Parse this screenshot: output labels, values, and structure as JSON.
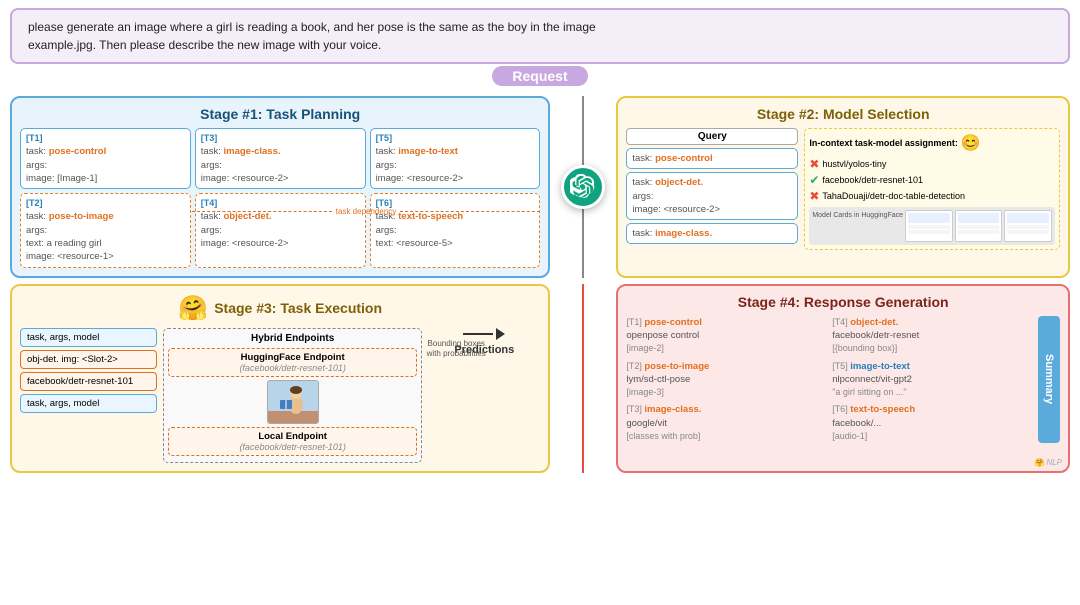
{
  "request": {
    "text_line1": "please generate an image where a girl is reading a book, and her pose is the same as the boy in the image",
    "text_line2": "example.jpg. Then please describe the new image with your voice.",
    "label": "Request"
  },
  "stage1": {
    "title": "Stage #1: Task Planning",
    "tasks": [
      {
        "id": "[T1]",
        "task_label": "task:",
        "task_value": "pose-control",
        "args_label": "args:",
        "image_label": "image:",
        "image_value": "[Image-1]"
      },
      {
        "id": "[T3]",
        "task_label": "task:",
        "task_value": "image-class.",
        "args_label": "args:",
        "image_label": "image:",
        "image_value": "<resource-2>"
      },
      {
        "id": "[T5]",
        "task_label": "task:",
        "task_value": "image-to-text",
        "args_label": "args:",
        "image_label": "image:",
        "image_value": "<resource-2>"
      },
      {
        "id": "[T2]",
        "task_label": "task:",
        "task_value": "pose-to-image",
        "args_label": "args:",
        "text_label": "text:",
        "text_value": "a reading girl",
        "image_label": "image:",
        "image_value": "<resource-1>"
      },
      {
        "id": "[T4]",
        "task_label": "task:",
        "task_value": "object-det.",
        "args_label": "args:",
        "image_label": "image:",
        "image_value": "<resource-2>"
      },
      {
        "id": "[T6]",
        "task_label": "task:",
        "task_value": "text-to-speech",
        "args_label": "args:",
        "text_label": "text:",
        "text_value": "<resource-5>"
      }
    ],
    "dep_label": "task dependency"
  },
  "stage2": {
    "title": "Stage #2: Model Selection",
    "query_label": "Query",
    "query_tasks": [
      {
        "label": "task:",
        "value": "pose-control",
        "color": "orange"
      },
      {
        "label": "task:",
        "value": "object-det.",
        "args": "args:",
        "image": "image:",
        "image_val": "<resource-2>",
        "color": "orange"
      },
      {
        "label": "task:",
        "value": "image-class.",
        "color": "orange"
      }
    ],
    "inctx_title": "In-context task-model assignment:",
    "models": [
      {
        "icon": "cross",
        "name": "hustvl/yolos-tiny"
      },
      {
        "icon": "check",
        "name": "facebook/detr-resnet-101"
      },
      {
        "icon": "cross",
        "name": "TahaDouaji/detr-doc-table-detection"
      }
    ],
    "model_cards_title": "Model Cards in HuggingFace"
  },
  "stage3": {
    "title": "Stage #3: Task Execution",
    "exec_cards": [
      {
        "text": "task, args, model",
        "type": "plain"
      },
      {
        "text": "obj-det. img: <Slot-2>",
        "type": "orange"
      },
      {
        "text": "facebook/detr-resnet-101",
        "type": "orange"
      },
      {
        "text": "task, args, model",
        "type": "plain"
      }
    ],
    "hybrid_title": "Hybrid Endpoints",
    "hf_endpoint": "HuggingFace Endpoint",
    "hf_model": "(facebook/detr-resnet-101)",
    "local_endpoint": "Local Endpoint",
    "local_model": "(facebook/detr-resnet-101)",
    "bb_label": "Bounding boxes\nwith probabilities",
    "predictions_label": "Predictions"
  },
  "stage4": {
    "title": "Stage #4: Response Generation",
    "results": [
      {
        "id": "[T1]",
        "task": "pose-control",
        "model": "openpose control",
        "resource": "[image-2]"
      },
      {
        "id": "[T2]",
        "task": "pose-to-image",
        "model": "lym/sd-ctl-pose",
        "resource": "[image-3]"
      },
      {
        "id": "[T3]",
        "task": "image-class.",
        "model": "google/vit",
        "resource": "[classes with prob]"
      },
      {
        "id": "[T4]",
        "task": "object-det.",
        "model": "facebook/detr-resnet",
        "resource": "[{bounding box}]"
      },
      {
        "id": "[T5]",
        "task": "image-to-text",
        "model": "nlpconnect/vit-gpt2",
        "resource": "\"a girl sitting on ...\""
      },
      {
        "id": "[T6]",
        "task": "text-to-speech",
        "model": "facebook/...",
        "resource": "[audio-1]"
      }
    ],
    "summary_label": "Summary"
  },
  "gpt": {
    "label": "ChatGPT"
  }
}
